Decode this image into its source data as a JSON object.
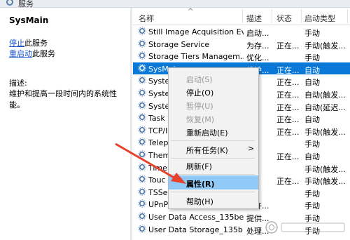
{
  "window": {
    "title": "服务"
  },
  "left_panel": {
    "service_name": "SysMain",
    "stop_link": "停止",
    "stop_suffix": "此服务",
    "restart_link": "重启动",
    "restart_suffix": "此服务",
    "desc_label": "描述:",
    "desc_text": "维护和提高一段时间内的系统性能。"
  },
  "columns": {
    "name": "名称",
    "desc": "描述",
    "status": "状态",
    "startup": "启动类型"
  },
  "rows": [
    {
      "name": "Still Image Acquisition Ev...",
      "desc": "启动...",
      "status": "",
      "startup": "手动",
      "tail": ""
    },
    {
      "name": "Storage Service",
      "desc": "为存...",
      "status": "正在...",
      "startup": "手动(触发...",
      "tail": ""
    },
    {
      "name": "Storage Tiers Managem...",
      "desc": "优化...",
      "status": "",
      "startup": "手动",
      "tail": ""
    },
    {
      "name": "SysMain",
      "desc": "维护...",
      "status": "正在...",
      "startup": "自动",
      "tail": ""
    },
    {
      "name": "Syste",
      "desc": "",
      "status": "正在...",
      "startup": "自动",
      "tail": ""
    },
    {
      "name": "Syste",
      "desc": "",
      "status": "正在...",
      "startup": "自动(触发...",
      "tail": ""
    },
    {
      "name": "Syste",
      "desc": "",
      "status": "正在...",
      "startup": "自动(延迟...",
      "tail": ""
    },
    {
      "name": "Task",
      "desc": "",
      "status": "正在...",
      "startup": "自动",
      "tail": ""
    },
    {
      "name": "TCP/I",
      "desc": "",
      "status": "正在...",
      "startup": "手动(触发...",
      "tail": ""
    },
    {
      "name": "Telep",
      "desc": "",
      "status": "",
      "startup": "手动",
      "tail": ""
    },
    {
      "name": "Them",
      "desc": "",
      "status": "正在...",
      "startup": "自动",
      "tail": ""
    },
    {
      "name": "Time",
      "desc": "",
      "status": "",
      "startup": "手动(触发...",
      "tail": ""
    },
    {
      "name": "Touc",
      "desc": "",
      "status": "正在...",
      "startup": "手动(触发...",
      "tail": ""
    },
    {
      "name": "TSSe",
      "desc": "",
      "status": "",
      "startup": "手动",
      "tail": ""
    },
    {
      "name": "UPnP Device Host",
      "desc": "允许...",
      "status": "",
      "startup": "手动",
      "tail": ""
    },
    {
      "name": "User Data Access_135be...",
      "desc": "提供...",
      "status": "",
      "startup": "手动",
      "tail": ""
    },
    {
      "name": "User Data Storage_135b...",
      "desc": "处理...",
      "status": "",
      "startup": "手动",
      "tail": ""
    }
  ],
  "context_menu": [
    {
      "label": "启动(S)",
      "disabled": true
    },
    {
      "label": "停止(O)",
      "disabled": false
    },
    {
      "label": "暂停(U)",
      "disabled": true
    },
    {
      "label": "恢复(M)",
      "disabled": true
    },
    {
      "label": "重新启动(E)",
      "disabled": false
    },
    {
      "label": "所有任务(K)",
      "disabled": false,
      "submenu_arrow": ">"
    },
    {
      "label": "刷新(F)",
      "disabled": false
    },
    {
      "label": "属性(R)",
      "disabled": false,
      "highlighted": true
    },
    {
      "label": "帮助(H)",
      "disabled": false
    }
  ],
  "colors": {
    "selection": "#0a78d7",
    "menu_highlight": "#91c9f7",
    "link": "#1a56c8",
    "arrow": "#e8412c"
  }
}
